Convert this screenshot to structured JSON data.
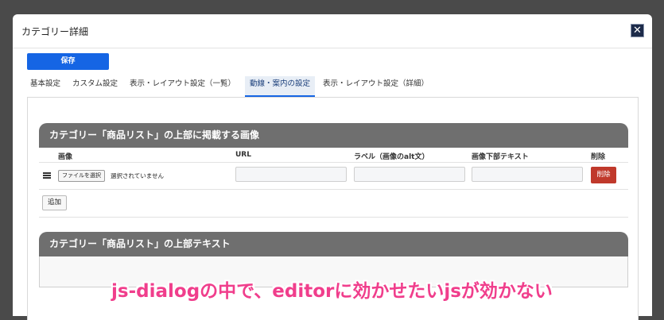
{
  "dialog": {
    "title": "カテゴリー詳細",
    "close_icon": "✕",
    "save_label": "保存"
  },
  "tabs": [
    {
      "label": "基本設定",
      "active": false
    },
    {
      "label": "カスタム設定",
      "active": false
    },
    {
      "label": "表示・レイアウト設定（一覧）",
      "active": false
    },
    {
      "label": "動線・案内の設定",
      "active": true
    },
    {
      "label": "表示・レイアウト設定（詳細）",
      "active": false
    }
  ],
  "section_images": {
    "title": "カテゴリー「商品リスト」の上部に掲載する画像",
    "columns": [
      "画像",
      "URL",
      "ラベル（画像のalt文）",
      "画像下部テキスト",
      "削除"
    ],
    "row": {
      "file_button": "ファイルを選択",
      "file_status": "選択されていません",
      "url": "",
      "label": "",
      "caption": "",
      "delete_label": "削除"
    },
    "add_label": "追加"
  },
  "section_text": {
    "title": "カテゴリー「商品リスト」の上部テキスト",
    "value": ""
  },
  "overlay_caption": "js-dialogの中で、editorに効かせたいjsが効かない"
}
